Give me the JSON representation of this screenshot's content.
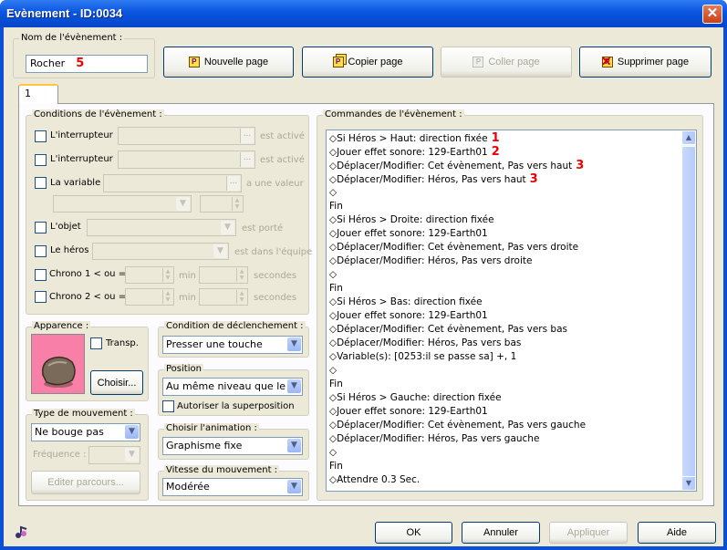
{
  "window": {
    "title": "Evènement - ID:0034",
    "close": "✕"
  },
  "name_group": {
    "legend": "Nom de l'évènement :",
    "value": "Rocher",
    "annotation": "5"
  },
  "toolbar": {
    "new_page": "Nouvelle page",
    "copy_page": "Copier page",
    "paste_page": "Coller page",
    "delete_page": "Supprimer page"
  },
  "tabs": [
    {
      "label": "1"
    }
  ],
  "conditions": {
    "legend": "Conditions de l'évènement :",
    "switch1": {
      "label": "L'interrupteur",
      "suffix": "est activé",
      "dots": "..."
    },
    "switch2": {
      "label": "L'interrupteur",
      "suffix": "est activé",
      "dots": "..."
    },
    "variable": {
      "label": "La variable",
      "suffix": "a une valeur",
      "dots": "..."
    },
    "item": {
      "label": "L'objet",
      "suffix": "est porté"
    },
    "hero": {
      "label": "Le héros",
      "suffix": "est dans l'équipe"
    },
    "timer1": {
      "label": "Chrono 1 < ou = à",
      "min": "min",
      "sec": "secondes"
    },
    "timer2": {
      "label": "Chrono 2 < ou = à",
      "min": "min",
      "sec": "secondes"
    }
  },
  "appearance": {
    "legend": "Apparence :",
    "transparent": "Transp.",
    "choose": "Choisir...",
    "colors": {
      "bg": "#f77fa8",
      "rock": "#7a6a5a"
    }
  },
  "trigger": {
    "legend": "Condition de déclenchement :",
    "value": "Presser une touche"
  },
  "position": {
    "legend": "Position",
    "value": "Au même niveau que le héros",
    "overlap": "Autoriser la superposition"
  },
  "animation": {
    "legend": "Choisir l'animation :",
    "value": "Graphisme fixe"
  },
  "speed": {
    "legend": "Vitesse du mouvement :",
    "value": "Modérée"
  },
  "movement": {
    "legend": "Type de mouvement :",
    "value": "Ne bouge pas",
    "frequency": "Fréquence :",
    "edit_route": "Editer parcours..."
  },
  "commands": {
    "legend": "Commandes de l'évènement :",
    "lines": [
      {
        "text": "◇Si Héros > Haut: direction fixée",
        "mark": "1"
      },
      {
        "text": " ◇Jouer effet sonore: 129-Earth01",
        "mark": "2"
      },
      {
        "text": " ◇Déplacer/Modifier: Cet évènement, Pas vers haut",
        "mark": "3"
      },
      {
        "text": " ◇Déplacer/Modifier: Héros, Pas vers haut",
        "mark": "3"
      },
      {
        "text": " ◇",
        "mark": ""
      },
      {
        "text": "Fin",
        "mark": ""
      },
      {
        "text": "◇Si Héros > Droite: direction fixée",
        "mark": ""
      },
      {
        "text": " ◇Jouer effet sonore: 129-Earth01",
        "mark": ""
      },
      {
        "text": " ◇Déplacer/Modifier: Cet évènement, Pas vers droite",
        "mark": ""
      },
      {
        "text": " ◇Déplacer/Modifier: Héros, Pas vers droite",
        "mark": ""
      },
      {
        "text": " ◇",
        "mark": ""
      },
      {
        "text": "Fin",
        "mark": ""
      },
      {
        "text": "◇Si Héros > Bas: direction fixée",
        "mark": ""
      },
      {
        "text": " ◇Jouer effet sonore: 129-Earth01",
        "mark": ""
      },
      {
        "text": " ◇Déplacer/Modifier: Cet évènement, Pas vers bas",
        "mark": ""
      },
      {
        "text": " ◇Déplacer/Modifier: Héros, Pas vers bas",
        "mark": ""
      },
      {
        "text": " ◇Variable(s): [0253:il se passe sa] +, 1",
        "mark": ""
      },
      {
        "text": " ◇",
        "mark": ""
      },
      {
        "text": "Fin",
        "mark": ""
      },
      {
        "text": "◇Si Héros > Gauche: direction fixée",
        "mark": ""
      },
      {
        "text": " ◇Jouer effet sonore: 129-Earth01",
        "mark": ""
      },
      {
        "text": " ◇Déplacer/Modifier: Cet évènement, Pas vers gauche",
        "mark": ""
      },
      {
        "text": " ◇Déplacer/Modifier: Héros, Pas vers gauche",
        "mark": ""
      },
      {
        "text": " ◇",
        "mark": ""
      },
      {
        "text": "Fin",
        "mark": ""
      },
      {
        "text": "◇Attendre 0.3 Sec.",
        "mark": ""
      }
    ]
  },
  "footer": {
    "ok": "OK",
    "cancel": "Annuler",
    "apply": "Appliquer",
    "help": "Aide"
  }
}
